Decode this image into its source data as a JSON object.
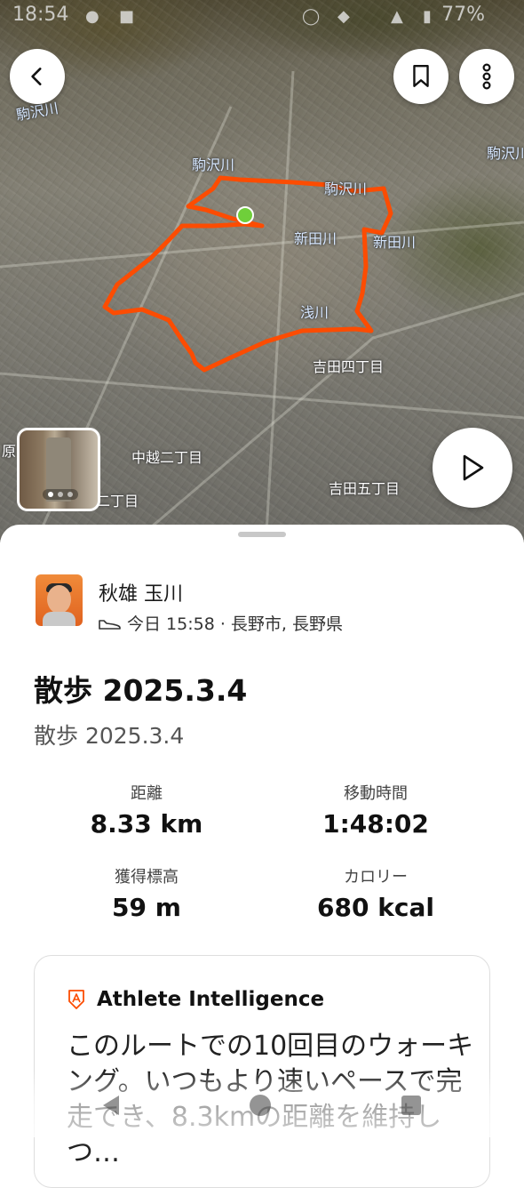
{
  "status_bar": {
    "time": "18:54",
    "battery": "77%"
  },
  "map": {
    "labels": [
      {
        "text": "駒沢川",
        "kind": "river"
      },
      {
        "text": "駒沢川",
        "kind": "river"
      },
      {
        "text": "駒沢川",
        "kind": "river"
      },
      {
        "text": "駒沢川",
        "kind": "river"
      },
      {
        "text": "新田川",
        "kind": "river"
      },
      {
        "text": "新田川",
        "kind": "river"
      },
      {
        "text": "浅川",
        "kind": "river"
      },
      {
        "text": "吉田四丁目",
        "kind": "place"
      },
      {
        "text": "中越二丁目",
        "kind": "place"
      },
      {
        "text": "吉田五丁目",
        "kind": "place"
      },
      {
        "text": "二丁目",
        "kind": "place"
      },
      {
        "text": "原",
        "kind": "place"
      }
    ],
    "route_color": "#fc4c02",
    "start_marker_color": "#6fcf3a"
  },
  "buttons": {
    "back_icon": "chevron-left-icon",
    "bookmark_icon": "bookmark-icon",
    "more_icon": "more-vertical-icon",
    "play_icon": "play-icon"
  },
  "athlete": {
    "name": "秋雄 玉川",
    "meta": "今日 15:58 · 長野市, 長野県",
    "activity_icon": "shoe-icon"
  },
  "activity": {
    "title": "散歩 2025.3.4",
    "description": "散歩 2025.3.4"
  },
  "stats": [
    {
      "label": "距離",
      "value": "8.33 km"
    },
    {
      "label": "移動時間",
      "value": "1:48:02"
    },
    {
      "label": "獲得標高",
      "value": "59 m"
    },
    {
      "label": "カロリー",
      "value": "680 kcal"
    }
  ],
  "insight": {
    "title": "Athlete Intelligence",
    "icon": "athlete-intelligence-icon",
    "body": "このルートでの10回目のウォーキング。いつもより速いペースで完走でき、8.3kmの距離を維持しつ…"
  },
  "colors": {
    "accent": "#fc4c02"
  }
}
